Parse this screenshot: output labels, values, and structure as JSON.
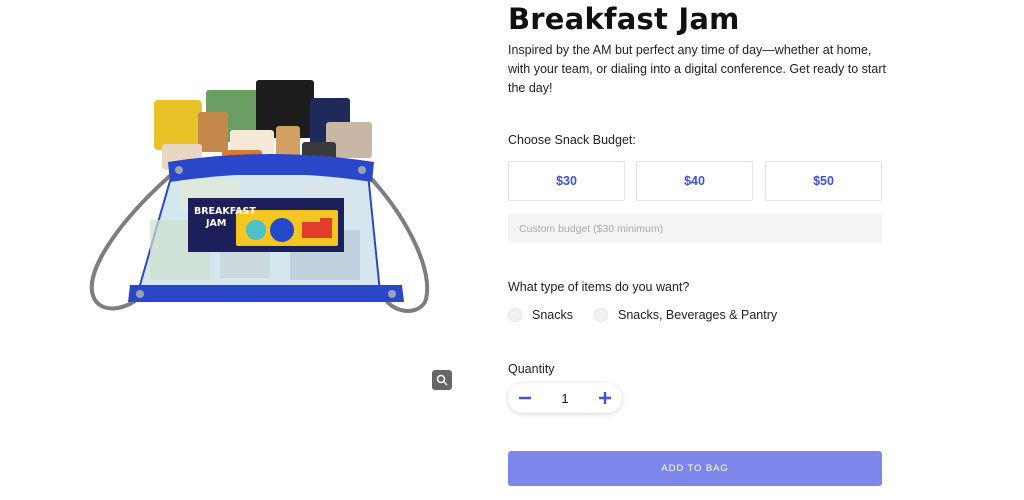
{
  "product": {
    "title": "Breakfast Jam",
    "description": "Inspired by the AM but perfect any time of day—whether at home, with your team, or dialing into a digital conference. Get ready to start the day!",
    "image_label_line1": "BREAKFAST",
    "image_label_line2": "JAM"
  },
  "budget": {
    "label": "Choose Snack Budget:",
    "options": [
      "$30",
      "$40",
      "$50"
    ],
    "custom_placeholder": "Custom budget ($30 minimum)"
  },
  "items_type": {
    "label": "What type of items do you want?",
    "options": [
      "Snacks",
      "Snacks, Beverages & Pantry"
    ]
  },
  "quantity": {
    "label": "Quantity",
    "value": "1"
  },
  "add_to_bag_label": "ADD TO BAG",
  "icons": {
    "zoom": "magnifier-icon",
    "decrement": "minus-icon",
    "increment": "plus-icon"
  },
  "colors": {
    "accent": "#3f51d6",
    "button": "#7b88ea",
    "bag": "#2b47c9"
  }
}
